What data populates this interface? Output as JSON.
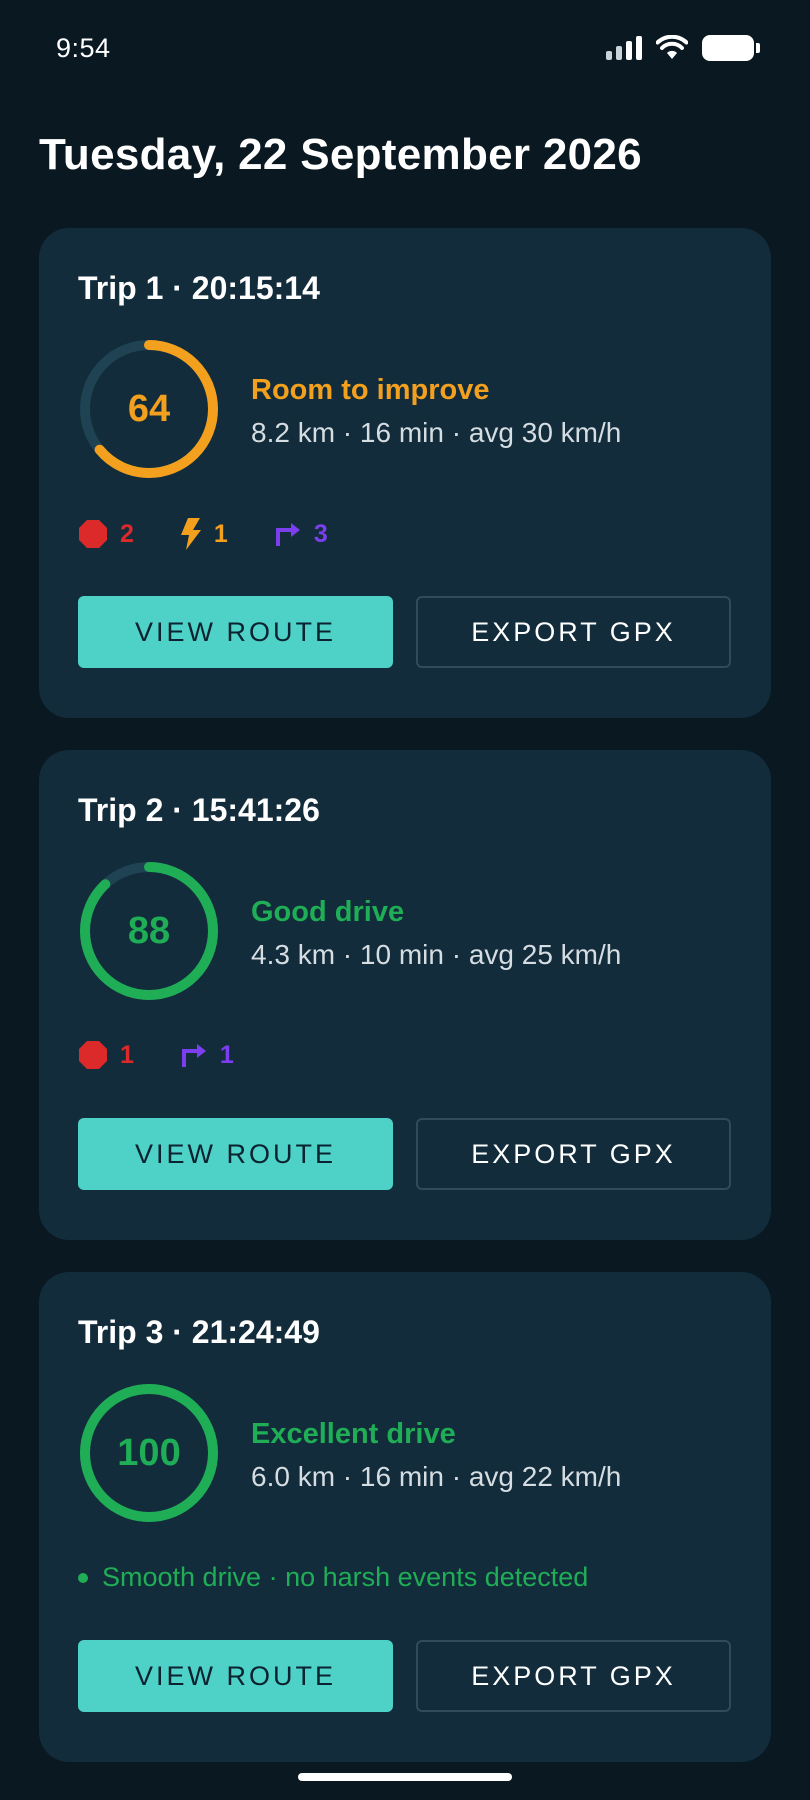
{
  "status_bar": {
    "time": "9:54"
  },
  "header": {
    "date": "Tuesday, 22 September 2026"
  },
  "colors": {
    "accent": "#4ed1c6",
    "card_background": "#122c3b",
    "app_background": "#0a1821",
    "score_good": "#1fae56",
    "score_medium": "#f2a01d",
    "brake": "#dc2a2a",
    "acceleration": "#f2a01d",
    "turn": "#7c3ff0"
  },
  "trips": [
    {
      "title": "Trip 1 · 20:15:14",
      "score": "64",
      "score_fraction": 0.64,
      "rating": "Room to improve",
      "rating_color": "#f2a01d",
      "stats": "8.2 km · 16 min · avg 30 km/h",
      "events": {
        "brake": "2",
        "acceleration": "1",
        "turn": "3"
      },
      "view_label": "VIEW ROUTE",
      "export_label": "EXPORT GPX"
    },
    {
      "title": "Trip 2 · 15:41:26",
      "score": "88",
      "score_fraction": 0.88,
      "rating": "Good drive",
      "rating_color": "#1fae56",
      "stats": "4.3 km · 10 min · avg 25 km/h",
      "events": {
        "brake": "1",
        "turn": "1"
      },
      "view_label": "VIEW ROUTE",
      "export_label": "EXPORT GPX"
    },
    {
      "title": "Trip 3 · 21:24:49",
      "score": "100",
      "score_fraction": 1.0,
      "rating": "Excellent drive",
      "rating_color": "#1fae56",
      "stats": "6.0 km · 16 min · avg 22 km/h",
      "note": "Smooth drive · no harsh events detected",
      "view_label": "VIEW ROUTE",
      "export_label": "EXPORT GPX"
    }
  ],
  "icons": {
    "brake": "stop-octagon-icon",
    "acceleration": "lightning-bolt-icon",
    "turn": "turn-right-arrow-icon"
  }
}
